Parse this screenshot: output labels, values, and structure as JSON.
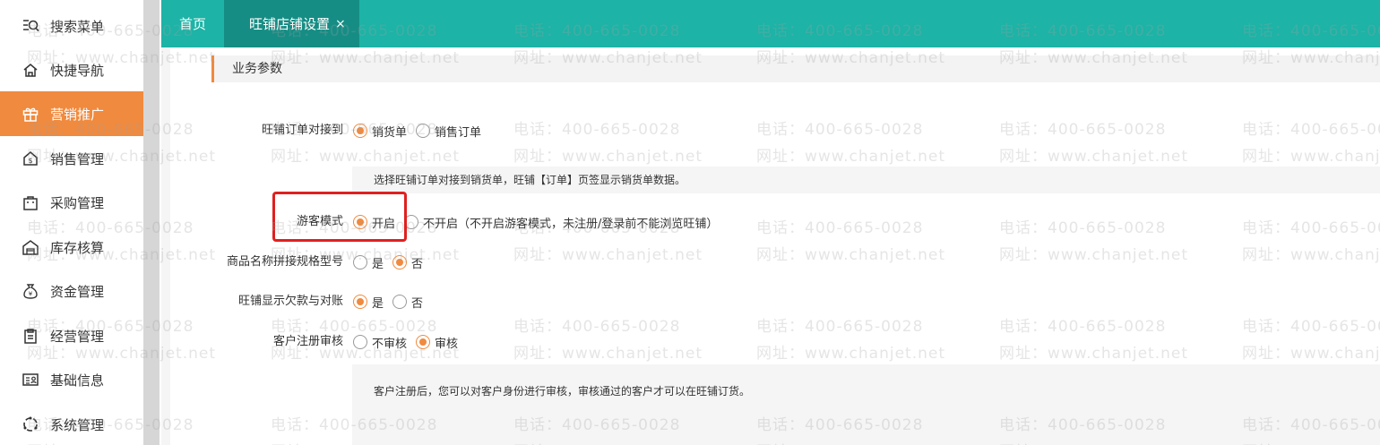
{
  "sidebar": {
    "items": [
      {
        "label": "搜索菜单",
        "icon": "search-menu-icon"
      },
      {
        "label": "快捷导航",
        "icon": "home-icon"
      },
      {
        "label": "营销推广",
        "icon": "gift-icon"
      },
      {
        "label": "销售管理",
        "icon": "sales-icon"
      },
      {
        "label": "采购管理",
        "icon": "bag-icon"
      },
      {
        "label": "库存核算",
        "icon": "warehouse-icon"
      },
      {
        "label": "资金管理",
        "icon": "money-icon"
      },
      {
        "label": "经营管理",
        "icon": "clipboard-icon"
      },
      {
        "label": "基础信息",
        "icon": "id-card-icon"
      },
      {
        "label": "系统管理",
        "icon": "settings-icon"
      }
    ],
    "active_index": 2
  },
  "tabs": {
    "home": "首页",
    "active": "旺铺店铺设置",
    "close": "×"
  },
  "section": {
    "title": "业务参数"
  },
  "settings": {
    "order_link": {
      "label": "旺铺订单对接到",
      "opt1": "销货单",
      "opt2": "销售订单",
      "selected": 1
    },
    "order_hint": "选择旺铺订单对接到销货单，旺铺【订单】页签显示销货单数据。",
    "guest_mode": {
      "label": "游客模式",
      "opt1": "开启",
      "opt2": "不开启（不开启游客模式，未注册/登录前不能浏览旺铺）",
      "selected": 1
    },
    "name_spec": {
      "label": "商品名称拼接规格型号",
      "opt1": "是",
      "opt2": "否",
      "selected": 2
    },
    "show_debt": {
      "label": "旺铺显示欠款与对账",
      "opt1": "是",
      "opt2": "否",
      "selected": 1
    },
    "register_audit": {
      "label": "客户注册审核",
      "opt1": "不审核",
      "opt2": "审核",
      "selected": 2
    },
    "register_hint": "客户注册后，您可以对客户身份进行审核，审核通过的客户才可以在旺铺订货。"
  },
  "watermark": {
    "phone": "电话：400-665-0028",
    "site": "网址：www.chanjet.net"
  },
  "colors": {
    "accent": "#f08a3e",
    "topbar": "#1db3a6",
    "tab_active": "#168d84",
    "highlight": "#e02020"
  }
}
